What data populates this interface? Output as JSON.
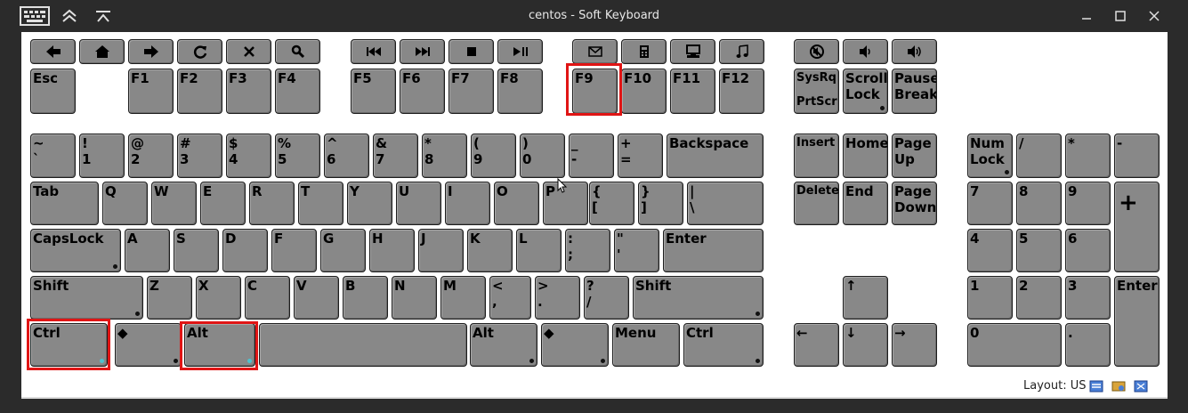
{
  "window": {
    "title": "centos - Soft Keyboard"
  },
  "footer": {
    "layout_label": "Layout: US"
  },
  "keys": {
    "esc": "Esc",
    "f1": "F1",
    "f2": "F2",
    "f3": "F3",
    "f4": "F4",
    "f5": "F5",
    "f6": "F6",
    "f7": "F7",
    "f8": "F8",
    "f9": "F9",
    "f10": "F10",
    "f11": "F11",
    "f12": "F12",
    "sysrq_top": "SysRq",
    "sysrq_bottom": "PrtScr",
    "scroll_top": "Scroll",
    "scroll_bottom": "Lock",
    "pause_top": "Pause",
    "pause_bottom": "Break",
    "tilde_top": "~",
    "tilde_bottom": "`",
    "n1_top": "!",
    "n1_bottom": "1",
    "n2_top": "@",
    "n2_bottom": "2",
    "n3_top": "#",
    "n3_bottom": "3",
    "n4_top": "$",
    "n4_bottom": "4",
    "n5_top": "%",
    "n5_bottom": "5",
    "n6_top": "^",
    "n6_bottom": "6",
    "n7_top": "&",
    "n7_bottom": "7",
    "n8_top": "*",
    "n8_bottom": "8",
    "n9_top": "(",
    "n9_bottom": "9",
    "n0_top": ")",
    "n0_bottom": "0",
    "minus_top": "_",
    "minus_bottom": "-",
    "equal_top": "+",
    "equal_bottom": "=",
    "backspace": "Backspace",
    "insert": "Insert",
    "home": "Home",
    "pgup_top": "Page",
    "pgup_bottom": "Up",
    "numlock_top": "Num",
    "numlock_bottom": "Lock",
    "np_div": "/",
    "np_mul": "*",
    "np_minus": "-",
    "tab": "Tab",
    "q": "Q",
    "w": "W",
    "e": "E",
    "r": "R",
    "t": "T",
    "y": "Y",
    "u": "U",
    "i": "I",
    "o": "O",
    "p": "P",
    "lbrace_top": "{",
    "lbrace_bottom": "[",
    "rbrace_top": "}",
    "rbrace_bottom": "]",
    "pipe_top": "|",
    "pipe_bottom": "\\",
    "delete": "Delete",
    "end": "End",
    "pgdn_top": "Page",
    "pgdn_bottom": "Down",
    "np7": "7",
    "np8": "8",
    "np9": "9",
    "np_plus": "+",
    "capslock": "CapsLock",
    "a": "A",
    "s": "S",
    "d": "D",
    "f": "F",
    "g": "G",
    "h": "H",
    "j": "J",
    "k": "K",
    "l": "L",
    "colon_top": ":",
    "colon_bottom": ";",
    "quote_top": "\"",
    "quote_bottom": "'",
    "enter": "Enter",
    "np4": "4",
    "np5": "5",
    "np6": "6",
    "lshift": "Shift",
    "z": "Z",
    "x": "X",
    "c": "C",
    "v": "V",
    "b": "B",
    "n": "N",
    "m": "M",
    "lt_top": "<",
    "lt_bottom": ",",
    "gt_top": ">",
    "gt_bottom": ".",
    "q_top": "?",
    "q_bottom": "/",
    "rshift": "Shift",
    "up": "↑",
    "np1": "1",
    "np2": "2",
    "np3": "3",
    "np_enter": "Enter",
    "lctrl": "Ctrl",
    "lwin": "◆",
    "lalt": "Alt",
    "ralt": "Alt",
    "rwin": "◆",
    "menu": "Menu",
    "rctrl": "Ctrl",
    "left": "←",
    "down": "↓",
    "right": "→",
    "np0": "0",
    "np_dot": "."
  }
}
